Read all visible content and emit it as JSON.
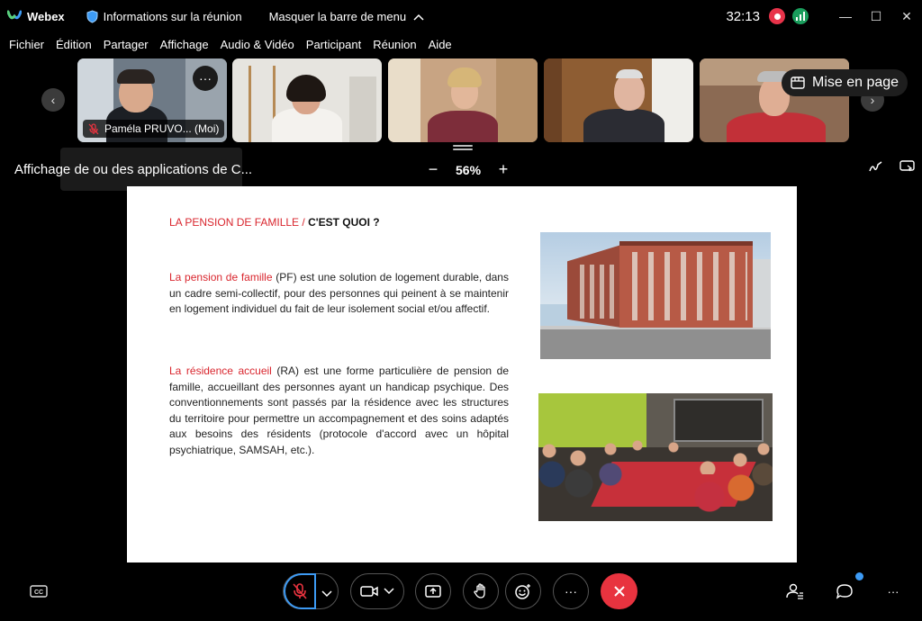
{
  "app": {
    "name": "Webex"
  },
  "titlebar": {
    "meeting_info": "Informations sur la réunion",
    "hide_menu": "Masquer la barre de menu",
    "timer": "32:13",
    "minimize": "—",
    "maximize": "☐",
    "close": "✕"
  },
  "menu": [
    "Fichier",
    "Édition",
    "Partager",
    "Affichage",
    "Audio & Vidéo",
    "Participant",
    "Réunion",
    "Aide"
  ],
  "participants": {
    "self_label": "Paméla PRUVO... (Moi)",
    "more": "···",
    "layout_button": "Mise en page",
    "prev": "‹",
    "next": "›"
  },
  "share": {
    "title": "Affichage de ou des applications de C...",
    "zoom_out": "−",
    "zoom_value": "56%",
    "zoom_in": "+"
  },
  "slide": {
    "title_red": "LA PENSION DE FAMILLE / ",
    "title_black": "C'EST QUOI  ?",
    "p1_red": "La pension de famille",
    "p1_text": " (PF) est une solution de logement durable, dans un cadre semi-collectif, pour des personnes qui peinent à se maintenir en logement individuel du fait de leur isolement social et/ou affectif.",
    "p2_red": "La résidence accueil",
    "p2_text": " (RA) est une forme particulière de pension de famille, accueillant des personnes ayant un handicap psychique. Des conventionnements sont passés par la résidence  avec les structures du territoire pour permettre un accompagnement et des soins adaptés aux besoins des résidents (protocole d'accord avec un hôpital psychiatrique, SAMSAH,  etc.)."
  },
  "controls": {
    "captions": "CC",
    "more": "···",
    "accent": "#e8333f"
  }
}
